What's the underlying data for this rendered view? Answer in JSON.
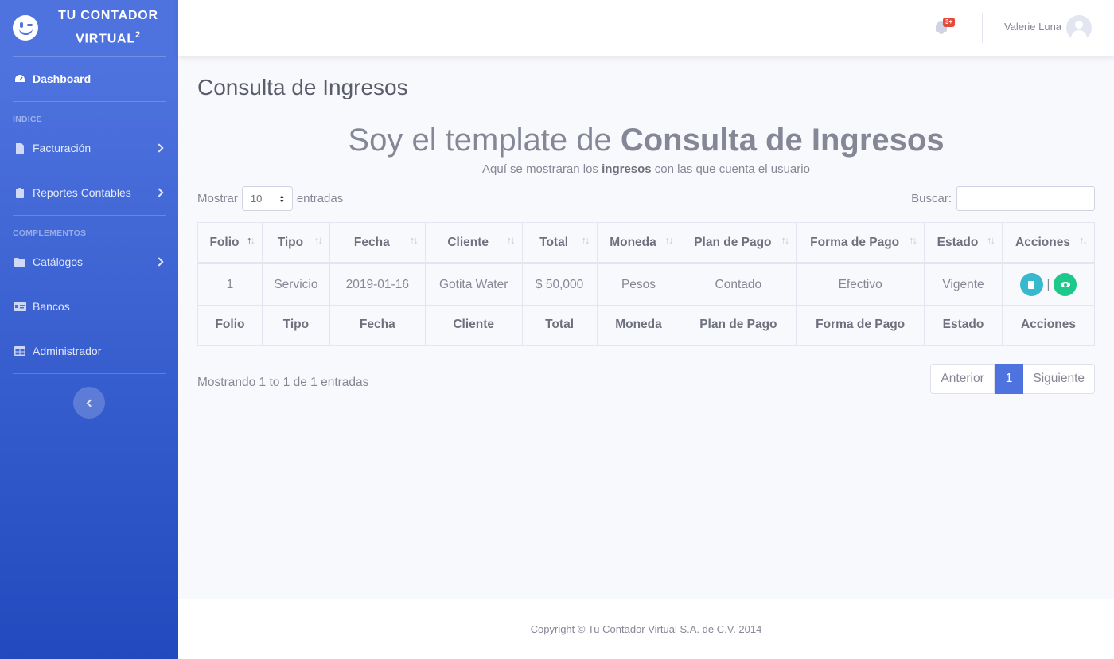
{
  "brand": {
    "line1": "TU CONTADOR",
    "line2": "VIRTUAL",
    "sup": "2"
  },
  "sidebar": {
    "dashboard": "Dashboard",
    "heading_indice": "ÍNDICE",
    "facturacion": "Facturación",
    "reportes": "Reportes Contables",
    "heading_complementos": "COMPLEMENTOS",
    "catalogos": "Catálogos",
    "bancos": "Bancos",
    "administrador": "Administrador"
  },
  "topbar": {
    "badge": "3+",
    "user_name": "Valerie Luna"
  },
  "main": {
    "page_title": "Consulta de Ingresos",
    "hero_prefix": "Soy el template de ",
    "hero_bold": "Consulta de Ingresos",
    "sub_prefix": "Aquí se mostraran los ",
    "sub_bold": "ingresos",
    "sub_suffix": " con las que cuenta el usuario",
    "show_label": "Mostrar",
    "show_value": "10",
    "entries_label": "entradas",
    "search_label": "Buscar:",
    "search_value": ""
  },
  "table": {
    "columns": [
      "Folio",
      "Tipo",
      "Fecha",
      "Cliente",
      "Total",
      "Moneda",
      "Plan de Pago",
      "Forma de Pago",
      "Estado",
      "Acciones"
    ],
    "rows": [
      [
        "1",
        "Servicio",
        "2019-01-16",
        "Gotita Water",
        "$ 50,000",
        "Pesos",
        "Contado",
        "Efectivo",
        "Vigente"
      ]
    ],
    "action_separator": "|"
  },
  "pagination": {
    "info": "Mostrando 1 to 1 de 1 entradas",
    "prev": "Anterior",
    "current": "1",
    "next": "Siguiente"
  },
  "footer": {
    "copyright": "Copyright © Tu Contador Virtual S.A. de C.V. 2014"
  },
  "colors": {
    "primary": "#4e73df",
    "info": "#36b9cc",
    "success": "#1cc88a",
    "danger": "#e74a3b"
  }
}
